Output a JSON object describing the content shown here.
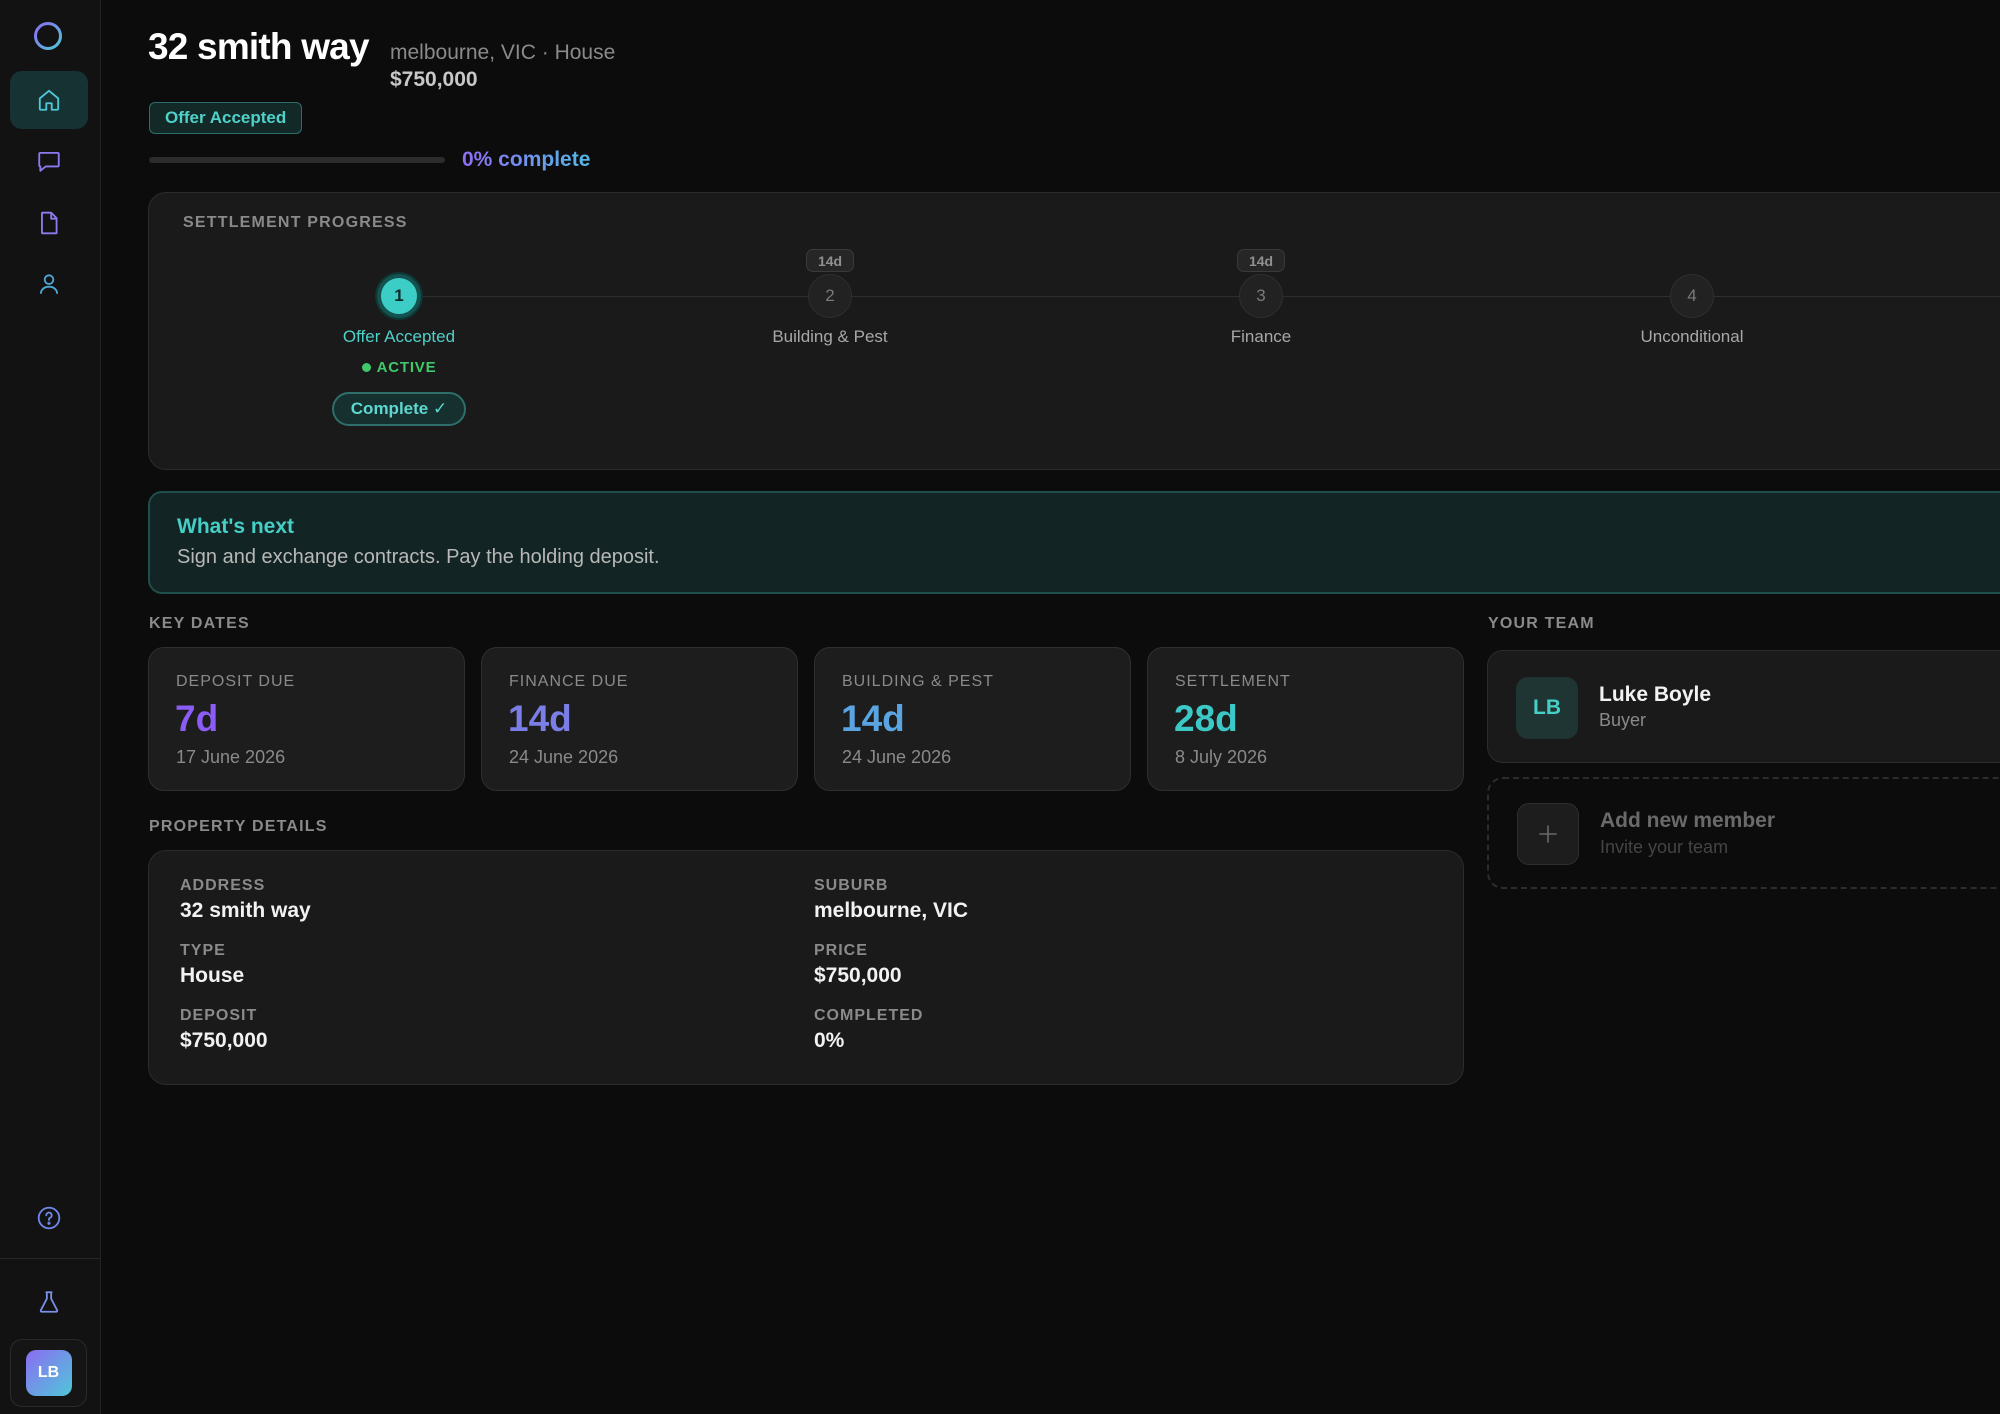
{
  "sidebar": {
    "items": [
      {
        "icon": "home-icon",
        "active": true
      },
      {
        "icon": "chat-icon",
        "active": false
      },
      {
        "icon": "document-icon",
        "active": false
      },
      {
        "icon": "user-icon",
        "active": false
      }
    ],
    "bottom_icons": [
      "help-icon",
      "flask-icon"
    ],
    "avatar_initials": "LB"
  },
  "header": {
    "title": "32 smith way",
    "subtitle": "melbourne, VIC · House",
    "price": "$750,000",
    "status_badge": "Offer Accepted",
    "progress_percent": 0,
    "progress_label": "0% complete"
  },
  "settlement": {
    "label": "SETTLEMENT PROGRESS",
    "steps": [
      {
        "number": "1",
        "name": "Offer Accepted",
        "status": "ACTIVE",
        "button": "Complete ✓",
        "duration": ""
      },
      {
        "number": "2",
        "name": "Building & Pest",
        "duration": "14d"
      },
      {
        "number": "3",
        "name": "Finance",
        "duration": "14d"
      },
      {
        "number": "4",
        "name": "Unconditional",
        "duration": ""
      }
    ]
  },
  "next": {
    "title": "What's next",
    "text": "Sign and exchange contracts. Pay the holding deposit."
  },
  "key_dates": {
    "label": "KEY DATES",
    "items": [
      {
        "title": "DEPOSIT DUE",
        "value": "7d",
        "date": "17 June 2026",
        "color": "#8b5cf6"
      },
      {
        "title": "FINANCE DUE",
        "value": "14d",
        "date": "24 June 2026",
        "color": "#7b7ee6"
      },
      {
        "title": "BUILDING & PEST",
        "value": "14d",
        "date": "24 June 2026",
        "color": "#5aa4e2"
      },
      {
        "title": "SETTLEMENT",
        "value": "28d",
        "date": "8 July 2026",
        "color": "#3cc8c6"
      }
    ]
  },
  "property": {
    "label": "PROPERTY DETAILS",
    "fields": [
      {
        "key": "ADDRESS",
        "value": "32 smith way"
      },
      {
        "key": "SUBURB",
        "value": "melbourne, VIC"
      },
      {
        "key": "TYPE",
        "value": "House"
      },
      {
        "key": "PRICE",
        "value": "$750,000"
      },
      {
        "key": "DEPOSIT",
        "value": "$750,000"
      },
      {
        "key": "COMPLETED",
        "value": "0%"
      }
    ]
  },
  "team": {
    "label": "YOUR TEAM",
    "members": [
      {
        "initials": "LB",
        "name": "Luke Boyle",
        "role": "Buyer"
      }
    ],
    "add": {
      "title": "Add new member",
      "subtitle": "Invite your team"
    }
  },
  "colors": {
    "accent_teal": "#3dcdc7",
    "accent_purple": "#8b5cf6",
    "status_green": "#3fc96a",
    "background": "#0c0c0c"
  }
}
